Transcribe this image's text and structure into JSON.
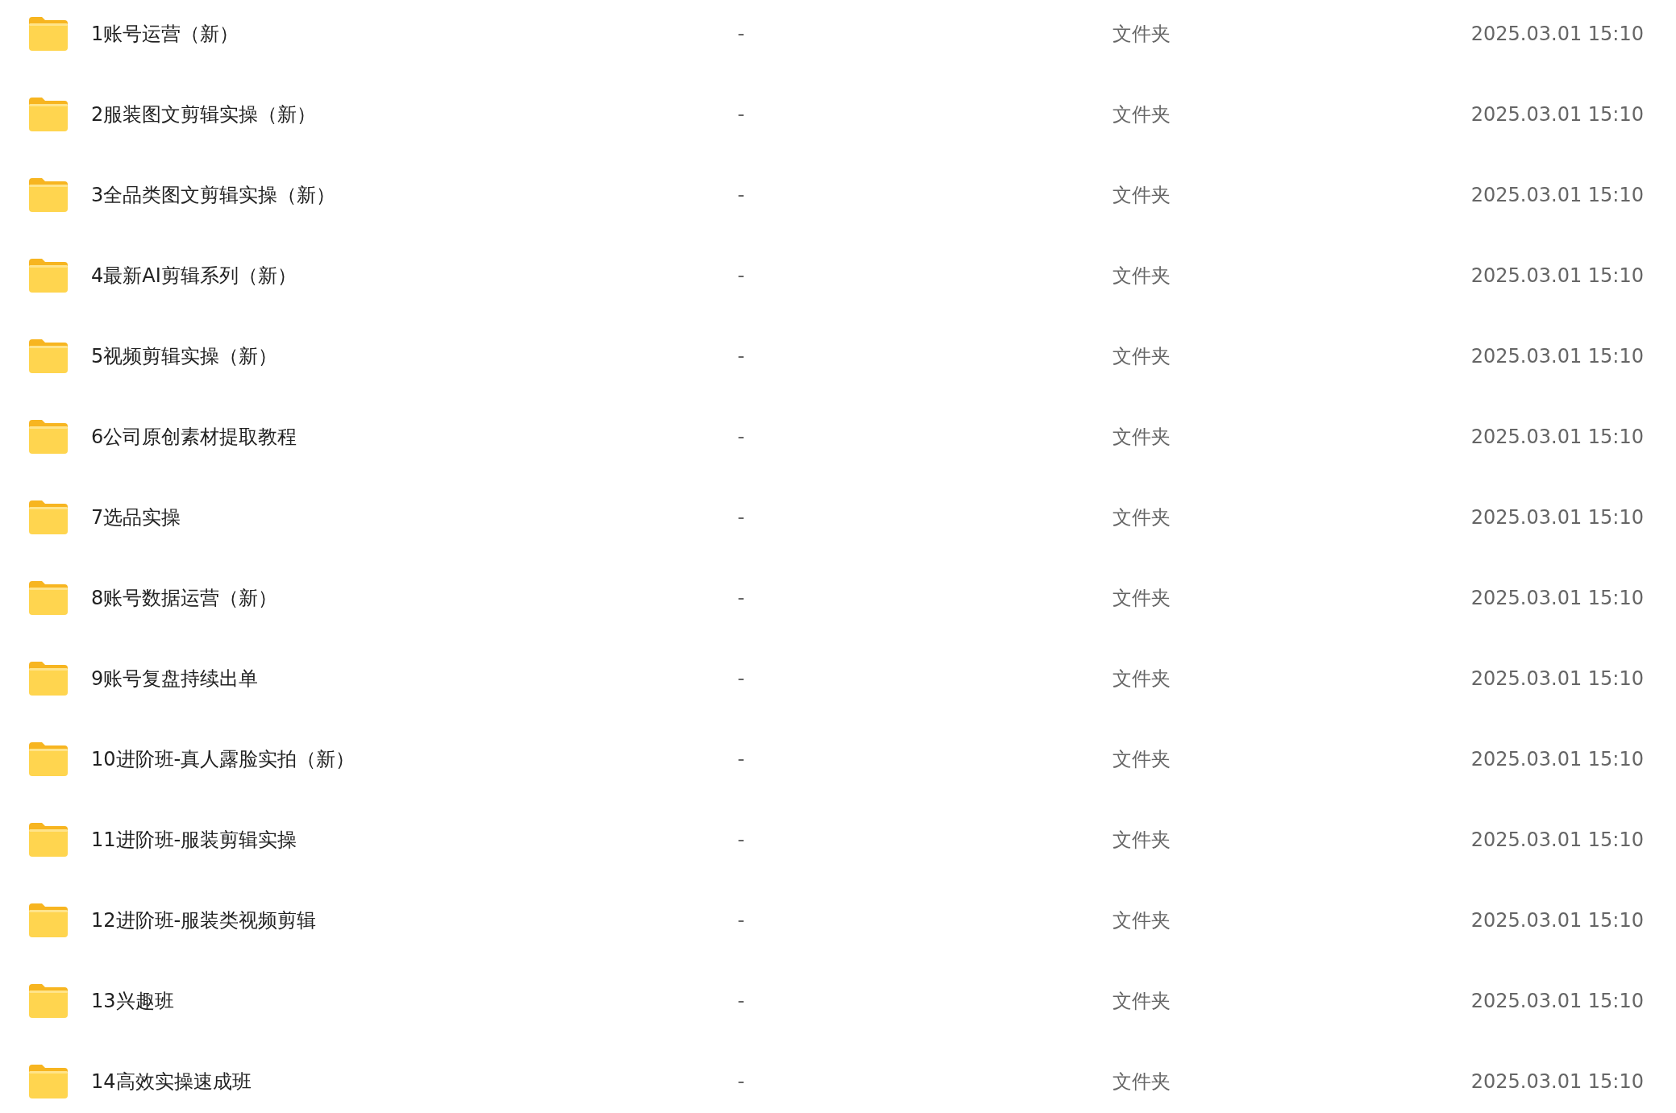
{
  "files": [
    {
      "name": "1账号运营（新）",
      "size": "-",
      "type": "文件夹",
      "modified": "2025.03.01 15:10"
    },
    {
      "name": "2服装图文剪辑实操（新）",
      "size": "-",
      "type": "文件夹",
      "modified": "2025.03.01 15:10"
    },
    {
      "name": "3全品类图文剪辑实操（新）",
      "size": "-",
      "type": "文件夹",
      "modified": "2025.03.01 15:10"
    },
    {
      "name": "4最新AI剪辑系列（新）",
      "size": "-",
      "type": "文件夹",
      "modified": "2025.03.01 15:10"
    },
    {
      "name": "5视频剪辑实操（新）",
      "size": "-",
      "type": "文件夹",
      "modified": "2025.03.01 15:10"
    },
    {
      "name": "6公司原创素材提取教程",
      "size": "-",
      "type": "文件夹",
      "modified": "2025.03.01 15:10"
    },
    {
      "name": "7选品实操",
      "size": "-",
      "type": "文件夹",
      "modified": "2025.03.01 15:10"
    },
    {
      "name": "8账号数据运营（新）",
      "size": "-",
      "type": "文件夹",
      "modified": "2025.03.01 15:10"
    },
    {
      "name": "9账号复盘持续出单",
      "size": "-",
      "type": "文件夹",
      "modified": "2025.03.01 15:10"
    },
    {
      "name": "10进阶班-真人露脸实拍（新）",
      "size": "-",
      "type": "文件夹",
      "modified": "2025.03.01 15:10"
    },
    {
      "name": "11进阶班-服装剪辑实操",
      "size": "-",
      "type": "文件夹",
      "modified": "2025.03.01 15:10"
    },
    {
      "name": "12进阶班-服装类视频剪辑",
      "size": "-",
      "type": "文件夹",
      "modified": "2025.03.01 15:10"
    },
    {
      "name": "13兴趣班",
      "size": "-",
      "type": "文件夹",
      "modified": "2025.03.01 15:10"
    },
    {
      "name": "14高效实操速成班",
      "size": "-",
      "type": "文件夹",
      "modified": "2025.03.01 15:10"
    }
  ]
}
